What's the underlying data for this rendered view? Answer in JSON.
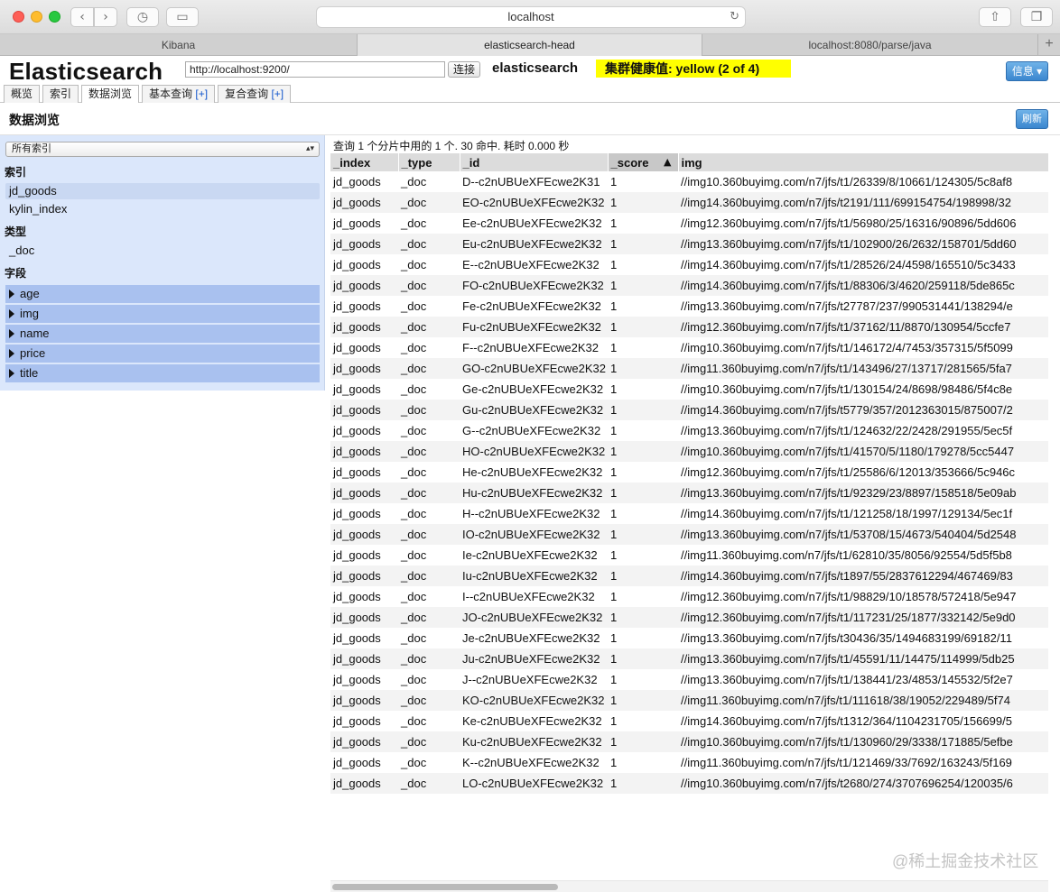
{
  "browser": {
    "url": "localhost",
    "tabs": [
      {
        "label": "Kibana",
        "active": false
      },
      {
        "label": "elasticsearch-head",
        "active": true
      },
      {
        "label": "localhost:8080/parse/java",
        "active": false
      }
    ],
    "new_tab": "+"
  },
  "header": {
    "brand": "Elasticsearch",
    "es_url": "http://localhost:9200/",
    "connect_label": "连接",
    "cluster_name": "elasticsearch",
    "health_text": "集群健康值: yellow (2 of 4)",
    "health_color": "#ffff00",
    "info_label": "信息 ▾",
    "tabs": [
      {
        "label": "概览"
      },
      {
        "label": "索引"
      },
      {
        "label": "数据浏览",
        "active": true
      },
      {
        "label": "基本查询",
        "plus": "[+]"
      },
      {
        "label": "复合查询",
        "plus": "[+]"
      }
    ]
  },
  "browse": {
    "title": "数据浏览",
    "refresh_label": "刷新",
    "index_select": "所有索引",
    "index_heading": "索引",
    "indices": [
      "jd_goods",
      "kylin_index"
    ],
    "type_heading": "类型",
    "types": [
      "_doc"
    ],
    "field_heading": "字段",
    "fields": [
      "age",
      "img",
      "name",
      "price",
      "title"
    ]
  },
  "results": {
    "summary": "查询 1 个分片中用的 1 个. 30 命中. 耗时 0.000 秒",
    "columns": [
      "_index",
      "_type",
      "_id",
      "_score",
      "img"
    ],
    "sort_arrow": "▲",
    "rows": [
      [
        "jd_goods",
        "_doc",
        "D--c2nUBUeXFEcwe2K31",
        "1",
        "//img10.360buyimg.com/n7/jfs/t1/26339/8/10661/124305/5c8af8"
      ],
      [
        "jd_goods",
        "_doc",
        "EO-c2nUBUeXFEcwe2K32",
        "1",
        "//img14.360buyimg.com/n7/jfs/t2191/111/699154754/198998/32"
      ],
      [
        "jd_goods",
        "_doc",
        "Ee-c2nUBUeXFEcwe2K32",
        "1",
        "//img12.360buyimg.com/n7/jfs/t1/56980/25/16316/90896/5dd606"
      ],
      [
        "jd_goods",
        "_doc",
        "Eu-c2nUBUeXFEcwe2K32",
        "1",
        "//img13.360buyimg.com/n7/jfs/t1/102900/26/2632/158701/5dd60"
      ],
      [
        "jd_goods",
        "_doc",
        "E--c2nUBUeXFEcwe2K32",
        "1",
        "//img14.360buyimg.com/n7/jfs/t1/28526/24/4598/165510/5c3433"
      ],
      [
        "jd_goods",
        "_doc",
        "FO-c2nUBUeXFEcwe2K32",
        "1",
        "//img14.360buyimg.com/n7/jfs/t1/88306/3/4620/259118/5de865c"
      ],
      [
        "jd_goods",
        "_doc",
        "Fe-c2nUBUeXFEcwe2K32",
        "1",
        "//img13.360buyimg.com/n7/jfs/t27787/237/990531441/138294/e"
      ],
      [
        "jd_goods",
        "_doc",
        "Fu-c2nUBUeXFEcwe2K32",
        "1",
        "//img12.360buyimg.com/n7/jfs/t1/37162/11/8870/130954/5ccfe7"
      ],
      [
        "jd_goods",
        "_doc",
        "F--c2nUBUeXFEcwe2K32",
        "1",
        "//img10.360buyimg.com/n7/jfs/t1/146172/4/7453/357315/5f5099"
      ],
      [
        "jd_goods",
        "_doc",
        "GO-c2nUBUeXFEcwe2K32",
        "1",
        "//img11.360buyimg.com/n7/jfs/t1/143496/27/13717/281565/5fa7"
      ],
      [
        "jd_goods",
        "_doc",
        "Ge-c2nUBUeXFEcwe2K32",
        "1",
        "//img10.360buyimg.com/n7/jfs/t1/130154/24/8698/98486/5f4c8e"
      ],
      [
        "jd_goods",
        "_doc",
        "Gu-c2nUBUeXFEcwe2K32",
        "1",
        "//img14.360buyimg.com/n7/jfs/t5779/357/2012363015/875007/2"
      ],
      [
        "jd_goods",
        "_doc",
        "G--c2nUBUeXFEcwe2K32",
        "1",
        "//img13.360buyimg.com/n7/jfs/t1/124632/22/2428/291955/5ec5f"
      ],
      [
        "jd_goods",
        "_doc",
        "HO-c2nUBUeXFEcwe2K32",
        "1",
        "//img10.360buyimg.com/n7/jfs/t1/41570/5/1180/179278/5cc5447"
      ],
      [
        "jd_goods",
        "_doc",
        "He-c2nUBUeXFEcwe2K32",
        "1",
        "//img12.360buyimg.com/n7/jfs/t1/25586/6/12013/353666/5c946c"
      ],
      [
        "jd_goods",
        "_doc",
        "Hu-c2nUBUeXFEcwe2K32",
        "1",
        "//img13.360buyimg.com/n7/jfs/t1/92329/23/8897/158518/5e09ab"
      ],
      [
        "jd_goods",
        "_doc",
        "H--c2nUBUeXFEcwe2K32",
        "1",
        "//img14.360buyimg.com/n7/jfs/t1/121258/18/1997/129134/5ec1f"
      ],
      [
        "jd_goods",
        "_doc",
        "IO-c2nUBUeXFEcwe2K32",
        "1",
        "//img13.360buyimg.com/n7/jfs/t1/53708/15/4673/540404/5d2548"
      ],
      [
        "jd_goods",
        "_doc",
        "Ie-c2nUBUeXFEcwe2K32",
        "1",
        "//img11.360buyimg.com/n7/jfs/t1/62810/35/8056/92554/5d5f5b8"
      ],
      [
        "jd_goods",
        "_doc",
        "Iu-c2nUBUeXFEcwe2K32",
        "1",
        "//img14.360buyimg.com/n7/jfs/t1897/55/2837612294/467469/83"
      ],
      [
        "jd_goods",
        "_doc",
        "I--c2nUBUeXFEcwe2K32",
        "1",
        "//img12.360buyimg.com/n7/jfs/t1/98829/10/18578/572418/5e947"
      ],
      [
        "jd_goods",
        "_doc",
        "JO-c2nUBUeXFEcwe2K32",
        "1",
        "//img12.360buyimg.com/n7/jfs/t1/117231/25/1877/332142/5e9d0"
      ],
      [
        "jd_goods",
        "_doc",
        "Je-c2nUBUeXFEcwe2K32",
        "1",
        "//img13.360buyimg.com/n7/jfs/t30436/35/1494683199/69182/11"
      ],
      [
        "jd_goods",
        "_doc",
        "Ju-c2nUBUeXFEcwe2K32",
        "1",
        "//img13.360buyimg.com/n7/jfs/t1/45591/11/14475/114999/5db25"
      ],
      [
        "jd_goods",
        "_doc",
        "J--c2nUBUeXFEcwe2K32",
        "1",
        "//img13.360buyimg.com/n7/jfs/t1/138441/23/4853/145532/5f2e7"
      ],
      [
        "jd_goods",
        "_doc",
        "KO-c2nUBUeXFEcwe2K32",
        "1",
        "//img11.360buyimg.com/n7/jfs/t1/111618/38/19052/229489/5f74"
      ],
      [
        "jd_goods",
        "_doc",
        "Ke-c2nUBUeXFEcwe2K32",
        "1",
        "//img14.360buyimg.com/n7/jfs/t1312/364/1104231705/156699/5"
      ],
      [
        "jd_goods",
        "_doc",
        "Ku-c2nUBUeXFEcwe2K32",
        "1",
        "//img10.360buyimg.com/n7/jfs/t1/130960/29/3338/171885/5efbe"
      ],
      [
        "jd_goods",
        "_doc",
        "K--c2nUBUeXFEcwe2K32",
        "1",
        "//img11.360buyimg.com/n7/jfs/t1/121469/33/7692/163243/5f169"
      ],
      [
        "jd_goods",
        "_doc",
        "LO-c2nUBUeXFEcwe2K32",
        "1",
        "//img10.360buyimg.com/n7/jfs/t2680/274/3707696254/120035/6"
      ]
    ]
  },
  "watermark": "@稀土掘金技术社区"
}
